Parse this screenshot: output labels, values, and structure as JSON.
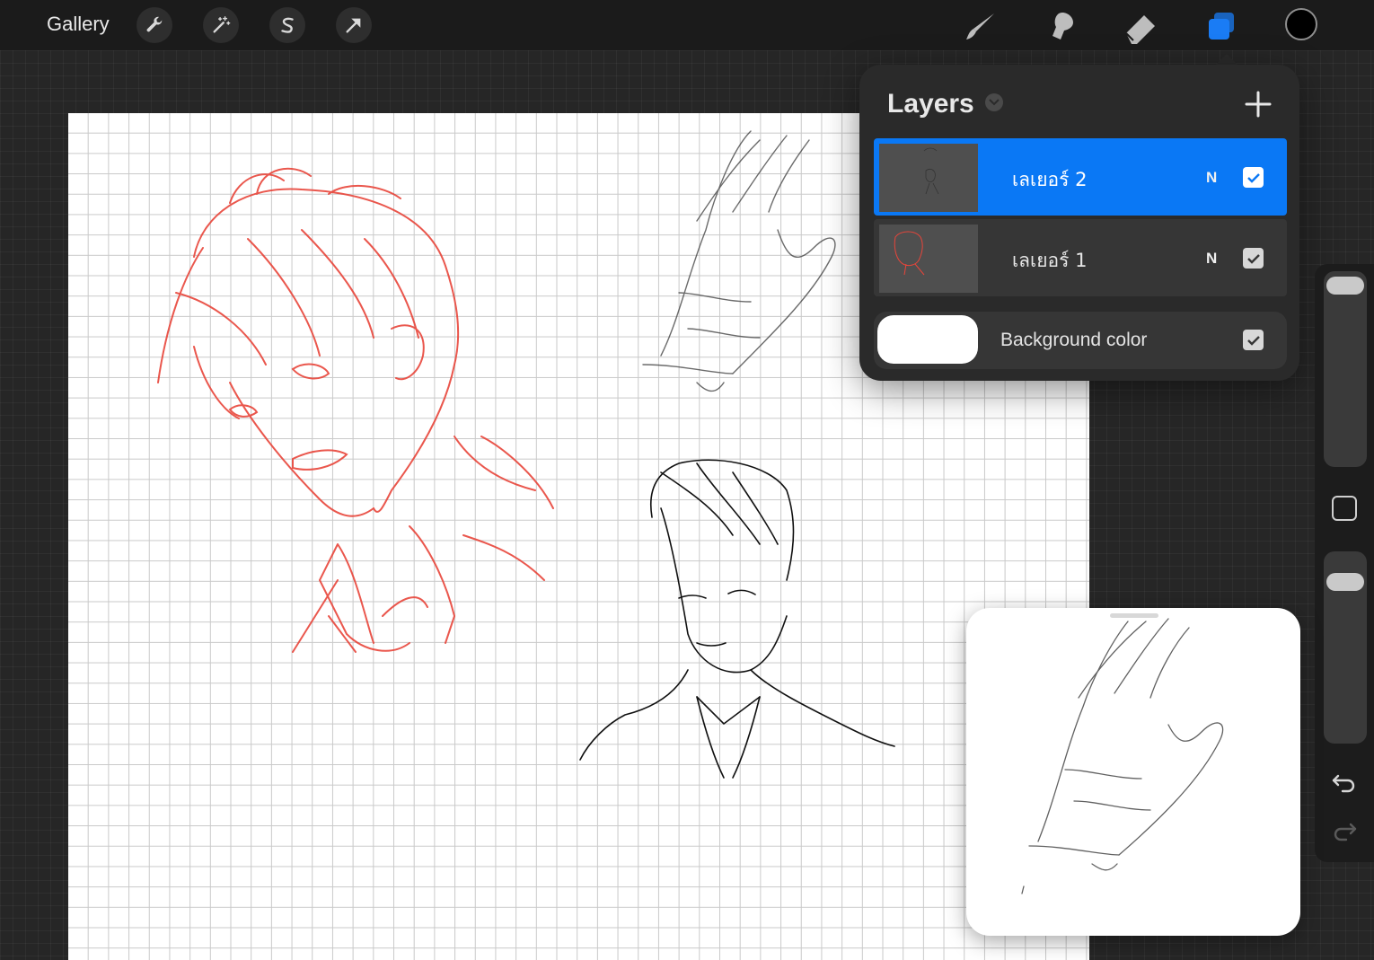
{
  "toolbar": {
    "gallery_label": "Gallery",
    "left_tools": [
      "wrench-icon",
      "magic-wand-icon",
      "selection-s-icon",
      "transform-arrow-icon"
    ],
    "right_tools": [
      "brush-icon",
      "smudge-icon",
      "eraser-icon",
      "layers-icon"
    ],
    "active_tool_color": "#1a7cf5",
    "current_color": "#000000"
  },
  "layers_panel": {
    "title": "Layers",
    "add_icon": "plus-icon",
    "layers": [
      {
        "name": "เลเยอร์ 2",
        "mode": "N",
        "visible": true,
        "active": true
      },
      {
        "name": "เลเยอร์ 1",
        "mode": "N",
        "visible": true,
        "active": false
      }
    ],
    "background": {
      "label": "Background color",
      "color": "#ffffff",
      "visible": true
    }
  },
  "sidebar": {
    "brush_size_icon": "size-slider",
    "modify_icon": "square-icon",
    "opacity_icon": "opacity-slider",
    "undo_icon": "undo-arrow-icon",
    "redo_icon": "redo-arrow-icon"
  },
  "canvas": {
    "paper_color": "#ffffff",
    "grid_color": "#c9c9c9",
    "sketch_red": "#e8453a",
    "sketch_dark": "#222222"
  },
  "reference_window": {
    "content": "hand-sketch"
  }
}
